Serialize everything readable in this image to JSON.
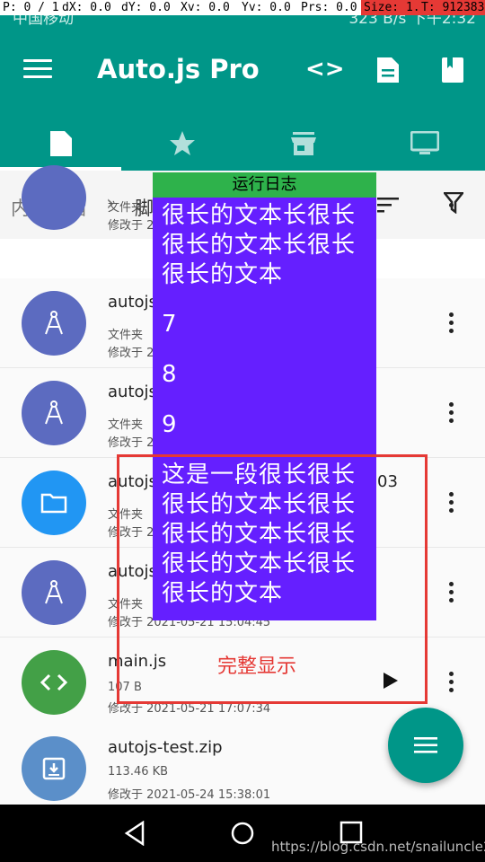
{
  "status_bar": {
    "carrier": "中国移动",
    "right": "323 B/s  下午2:32",
    "debug": [
      "P: 0 / 1",
      "dX: 0.0",
      "dY: 0.0",
      "Xv: 0.0",
      "Yv: 0.0",
      "Prs: 0.0",
      "Size: 1.0",
      "T: 912383"
    ]
  },
  "appbar": {
    "title": "Auto.js Pro",
    "code_icon_label": "<>"
  },
  "tabs": [
    "scripts-tab",
    "starred-tab",
    "store-tab",
    "devices-tab"
  ],
  "breadcrumb": {
    "root": "内部存储",
    "current": "脚"
  },
  "files": [
    {
      "name": "",
      "type": "文件夹",
      "modified": "修改于 2"
    },
    {
      "name": "autojs",
      "type": "文件夹",
      "modified": "修改于 2"
    },
    {
      "name": "autojs",
      "type": "文件夹",
      "modified": "修改于 2"
    },
    {
      "name": "autojs",
      "name_suffix": "03",
      "type": "文件夹",
      "modified": "修改于 2"
    },
    {
      "name": "autojs",
      "type": "文件夹",
      "modified": "修改于 2021-05-21 15:04:45"
    },
    {
      "name": "main.js",
      "type": "107 B",
      "modified": "修改于 2021-05-21 17:07:34"
    },
    {
      "name": "autojs-test.zip",
      "type": "113.46 KB",
      "modified": "修改于 2021-05-24 15:38:01"
    }
  ],
  "log": {
    "title": "运行日志",
    "lines": [
      "很长的文本长很长很长的文本长很长很长的文本",
      "7",
      "8",
      "9",
      "这是一段很长很长很长的文本长很长很长的文本长很长很长的文本长很长很长的文本"
    ]
  },
  "annotation": {
    "label": "完整显示"
  },
  "watermark": "https://blog.csdn.net/snailuncle2",
  "colors": {
    "primary": "#009688",
    "log_head": "#2eb24b",
    "log_body": "#651fff",
    "annotation": "#e53935"
  }
}
